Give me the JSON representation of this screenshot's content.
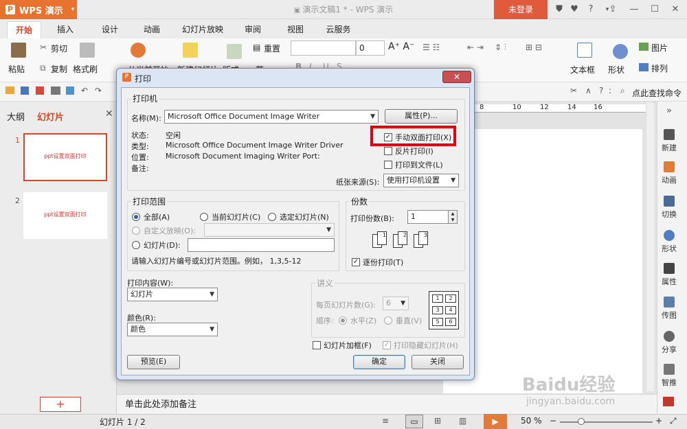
{
  "app": {
    "name": "WPS 演示",
    "window_title": "演示文稿1 * - WPS 演示",
    "login": "未登录"
  },
  "titlebar_icons": [
    "shirt-icon",
    "skin-icon",
    "help-icon",
    "dash-icon",
    "restore-icon",
    "minimize-icon",
    "maximize-icon",
    "close-icon"
  ],
  "tabs": [
    {
      "label": "开始",
      "active": true
    },
    {
      "label": "插入",
      "active": false
    },
    {
      "label": "设计",
      "active": false
    },
    {
      "label": "动画",
      "active": false
    },
    {
      "label": "幻灯片放映",
      "active": false
    },
    {
      "label": "审阅",
      "active": false
    },
    {
      "label": "视图",
      "active": false
    },
    {
      "label": "云服务",
      "active": false
    }
  ],
  "ribbon": {
    "paste": "粘贴",
    "cut": "剪切",
    "copy": "复制",
    "format_painter": "格式刷",
    "from_current": "从当前开始",
    "new_slide": "新建幻灯片",
    "layout": "版式",
    "reset": "重置",
    "section": "节",
    "font_size": "0",
    "textbox": "文本框",
    "shape": "形状",
    "picture": "图片",
    "arrange": "排列",
    "find_cmd": "点此查找命令"
  },
  "left_panel": {
    "tab_outline": "大纲",
    "tab_slides": "幻灯片",
    "slides": [
      {
        "num": "1",
        "text": "ppt设置双面打印"
      },
      {
        "num": "2",
        "text": "ppt设置双面打印"
      }
    ],
    "add": "+"
  },
  "ruler_labels": [
    "8",
    "10",
    "12",
    "14",
    "16"
  ],
  "notes_placeholder": "单击此处添加备注",
  "right_bar": [
    "新建",
    "动画",
    "切换",
    "形状",
    "属性",
    "传图",
    "分享",
    "智推"
  ],
  "status": {
    "slide_info": "幻灯片 1 / 2",
    "zoom": "50 %"
  },
  "watermark": {
    "brand": "Baidu经验",
    "url": "jingyan.baidu.com"
  },
  "dialog": {
    "title": "打印",
    "close": "✕",
    "printer": {
      "group": "打印机",
      "name_label": "名称(M):",
      "name_value": "Microsoft Office Document Image Writer",
      "properties_btn": "属性(P)...",
      "status_label": "状态:",
      "status_value": "空闲",
      "type_label": "类型:",
      "type_value": "Microsoft Office Document Image Writer Driver",
      "where_label": "位置:",
      "where_value": "Microsoft Document Imaging Writer Port:",
      "comment_label": "备注:",
      "manual_duplex": "手动双面打印(X)",
      "manual_duplex_checked": true,
      "reverse": "反片打印(I)",
      "reverse_checked": false,
      "to_file": "打印到文件(L)",
      "to_file_checked": false,
      "paper_source_label": "纸张来源(S):",
      "paper_source_value": "使用打印机设置"
    },
    "range": {
      "group": "打印范围",
      "all": "全部(A)",
      "current": "当前幻灯片(C)",
      "selected": "选定幻灯片(N)",
      "custom": "自定义放映(O):",
      "slides": "幻灯片(D):",
      "hint": "请输入幻灯片编号或幻灯片范围。例如， 1,3,5-12"
    },
    "copies": {
      "group": "份数",
      "label": "打印份数(B):",
      "value": "1",
      "collate": "逐份打印(T)",
      "collate_checked": true
    },
    "content": {
      "label": "打印内容(W):",
      "value": "幻灯片"
    },
    "color": {
      "label": "颜色(R):",
      "value": "颜色"
    },
    "handouts": {
      "group": "讲义",
      "per_page_label": "每页幻灯片数(G):",
      "per_page_value": "6",
      "order_label": "顺序:",
      "horizontal": "水平(Z)",
      "vertical": "垂直(V)",
      "grid": [
        "1",
        "2",
        "3",
        "4",
        "5",
        "6"
      ]
    },
    "frame": "幻灯片加框(F)",
    "frame_checked": false,
    "print_hidden": "打印隐藏幻灯片(H)",
    "print_hidden_checked": true,
    "preview_btn": "预览(E)",
    "ok_btn": "确定",
    "cancel_btn": "关闭"
  }
}
